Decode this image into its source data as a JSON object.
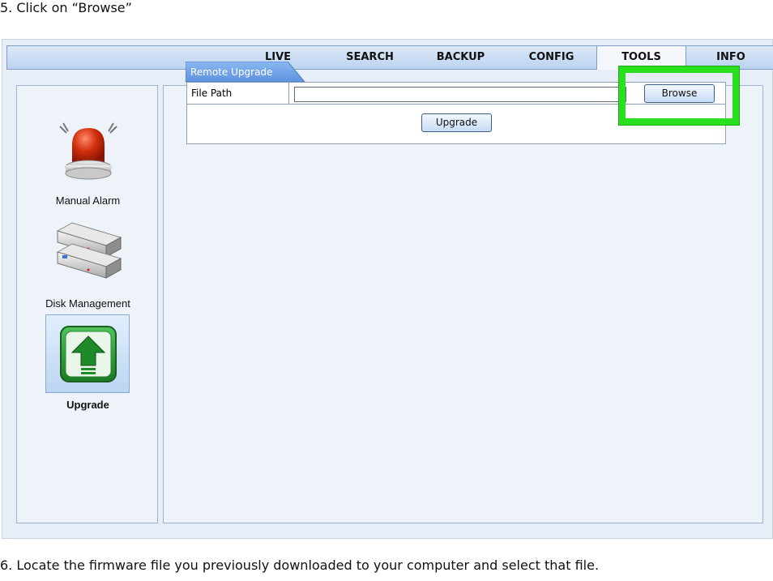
{
  "instructions": {
    "step5": "5. Click on “Browse”",
    "step6": "6. Locate the firmware file you previously downloaded to your computer and select that file."
  },
  "nav": {
    "tabs": [
      {
        "label": "LIVE",
        "active": false
      },
      {
        "label": "SEARCH",
        "active": false
      },
      {
        "label": "BACKUP",
        "active": false
      },
      {
        "label": "CONFIG",
        "active": false
      },
      {
        "label": "TOOLS",
        "active": true
      },
      {
        "label": "INFO",
        "active": false
      }
    ]
  },
  "sidebar": {
    "items": [
      {
        "label": "Manual Alarm",
        "icon": "alarm-beacon-icon"
      },
      {
        "label": "Disk Management",
        "icon": "hard-disk-icon"
      },
      {
        "label": "Upgrade",
        "icon": "upgrade-arrow-icon",
        "selected": true
      }
    ]
  },
  "remote_upgrade": {
    "title": "Remote Upgrade",
    "file_path_label": "File Path",
    "file_path_value": "",
    "browse_label": "Browse",
    "upgrade_label": "Upgrade"
  },
  "colors": {
    "highlight": "#29e01f",
    "tab_header": "#6fa3ea"
  }
}
